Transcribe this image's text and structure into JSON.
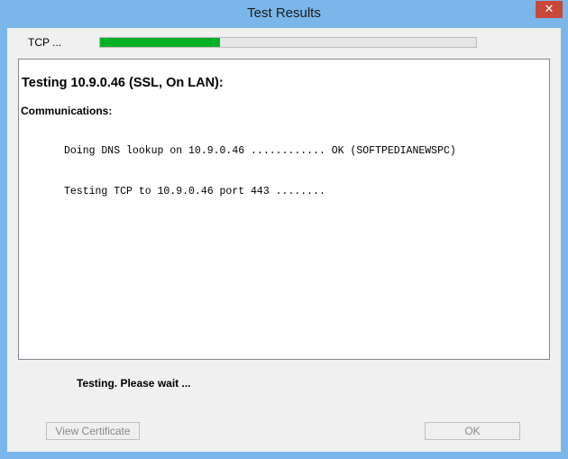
{
  "window": {
    "title": "Test Results",
    "close_glyph": "✕"
  },
  "progress": {
    "label": "TCP ...",
    "fraction": 0.32,
    "color": "#06b025"
  },
  "results": {
    "heading": "Testing 10.9.0.46 (SSL, On LAN):",
    "section_label": "Communications:",
    "lines": [
      "Doing DNS lookup on 10.9.0.46 ............ OK (SOFTPEDIANEWSPC)",
      "Testing TCP to 10.9.0.46 port 443 ........"
    ]
  },
  "status": {
    "message": "Testing. Please wait ..."
  },
  "buttons": {
    "view_certificate": "View Certificate",
    "ok": "OK"
  }
}
